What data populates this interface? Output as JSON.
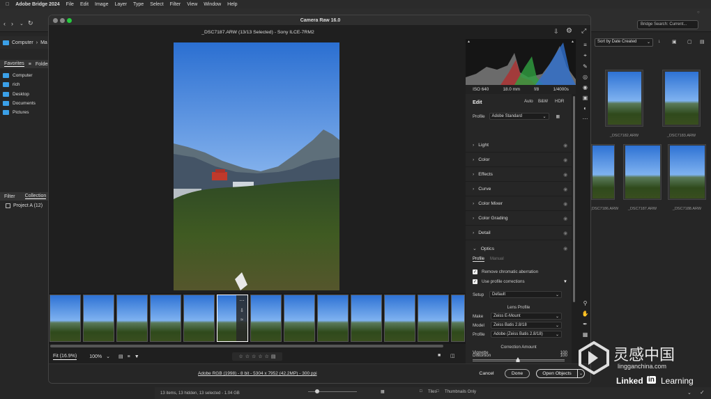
{
  "menubar": {
    "app": "Adobe Bridge 2024",
    "items": [
      "File",
      "Edit",
      "Image",
      "Layer",
      "Type",
      "Select",
      "Filter",
      "View",
      "Window",
      "Help"
    ]
  },
  "bridge": {
    "search_placeholder": "Bridge Search: Current...",
    "path": [
      "Computer",
      "Ma"
    ],
    "panel_tabs": [
      "Favorites",
      "Folder"
    ],
    "favorites": [
      "Computer",
      "rich",
      "Desktop",
      "Documents",
      "Pictures"
    ],
    "filter_tabs": [
      "Filter",
      "Collection"
    ],
    "collection_item": "Project A (12)",
    "sort": "Sort by Date Created",
    "thumb_labels": [
      "_DSC7182.ARW",
      "_DSC7183.ARW",
      "_DSC7186.ARW",
      "_DSC7187.ARW",
      "_DSC7188.ARW"
    ],
    "status": "13 items, 13 hidden, 13 selected - 1.04 GB",
    "status_right": [
      "Tiles",
      "Thumbnails Only"
    ]
  },
  "camera_raw": {
    "title": "Camera Raw 16.0",
    "filename": "_DSC7187.ARW (13/13 Selected)  -  Sony ILCE-7RM2",
    "exif": [
      "ISO 640",
      "18.0 mm",
      "f/8",
      "1/4000s"
    ],
    "edit": {
      "heading": "Edit",
      "modes": [
        "Auto",
        "B&W",
        "HDR"
      ],
      "profile_label": "Profile",
      "profile_value": "Adobe Standard",
      "sections": [
        "Light",
        "Color",
        "Effects",
        "Curve",
        "Color Mixer",
        "Color Grading",
        "Detail",
        "Optics"
      ],
      "optics": {
        "tabs": [
          "Profile",
          "Manual"
        ],
        "remove_ca": "Remove chromatic aberration",
        "use_profile": "Use profile corrections",
        "setup_label": "Setup",
        "setup_value": "Default",
        "lens_profile_heading": "Lens Profile",
        "make_label": "Make",
        "make_value": "Zeiss E-Mount",
        "model_label": "Model",
        "model_value": "Zeiss Batis 2.8/18",
        "profile_label": "Profile",
        "profile_value": "Adobe (Zeiss Batis 2.8/18)",
        "correction_heading": "Correction Amount",
        "distortion_label": "Distortion",
        "distortion_value": "100",
        "vignette_label": "Vignette",
        "vignette_value": "100"
      }
    },
    "view": {
      "fit": "Fit (16.9%)",
      "zoom": "100%"
    },
    "color_info": "Adobe RGB (1998) - 8 bit - 5304 x 7952 (42.2MP) - 300 ppi",
    "buttons": {
      "cancel": "Cancel",
      "done": "Done",
      "open": "Open Objects"
    }
  },
  "watermark": {
    "cn": "灵感中国",
    "url": "lingganchina.com",
    "linkedin": "Linked",
    "in": "in",
    "learning": "Learning"
  },
  "colors": {
    "accent": "#3ba0e8",
    "panel": "#262626",
    "window": "#1f1f1f"
  }
}
